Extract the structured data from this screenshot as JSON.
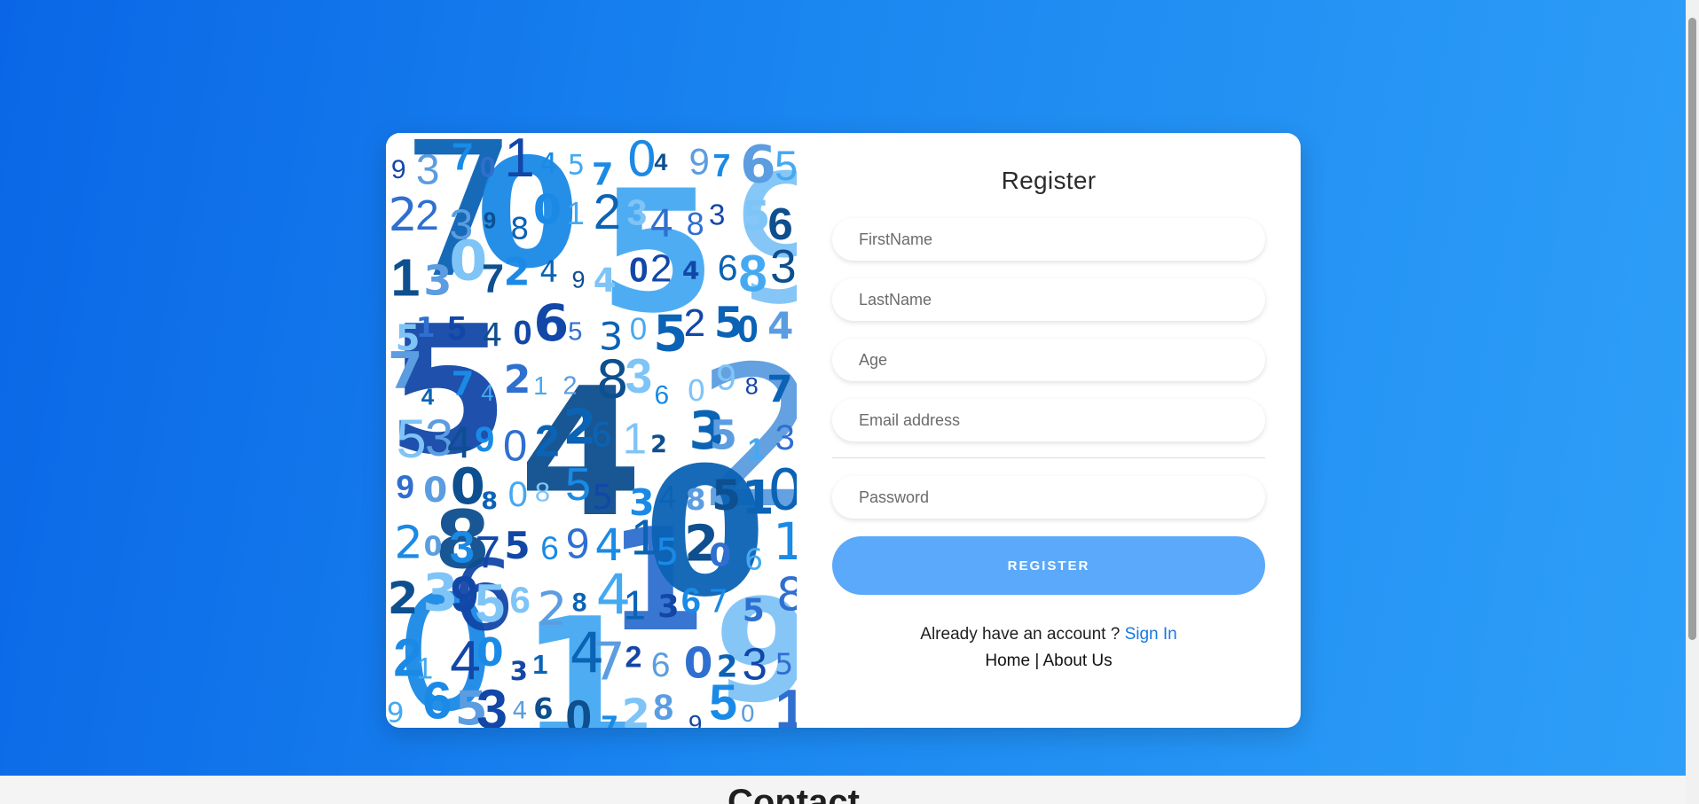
{
  "register": {
    "title": "Register",
    "fields": {
      "first_name_placeholder": "FirstName",
      "last_name_placeholder": "LastName",
      "age_placeholder": "Age",
      "email_placeholder": "Email address",
      "password_placeholder": "Password"
    },
    "submit_label": "REGISTER",
    "account_prompt": "Already have an account ?",
    "signin_label": "Sign In",
    "home_label": "Home",
    "separator": "|",
    "about_label": "About Us"
  },
  "footer": {
    "heading": "Contact"
  },
  "colors": {
    "hero_start": "#0a66e6",
    "hero_end": "#2e9ff8",
    "button": "#5aa9fa",
    "link": "#1878e6"
  },
  "icons": {
    "art": "numbers-pattern-image"
  },
  "art_digits": [
    "9",
    "3",
    "7",
    "0",
    "1",
    "4",
    "5",
    "7",
    "0",
    "4",
    "9",
    "7",
    "6",
    "5",
    "2",
    "2",
    "3",
    "9",
    "8",
    "0",
    "1",
    "2",
    "3",
    "4",
    "8",
    "3",
    "5",
    "6",
    "1",
    "3",
    "0",
    "7",
    "2",
    "4",
    "9",
    "4",
    "0",
    "2",
    "4",
    "6",
    "8",
    "3",
    "5",
    "1",
    "5",
    "4",
    "0",
    "6",
    "5",
    "3",
    "0",
    "5",
    "2",
    "5",
    "0",
    "4",
    "7",
    "4",
    "7",
    "4",
    "2",
    "1",
    "2",
    "8",
    "3",
    "6",
    "0",
    "9",
    "8",
    "7",
    "5",
    "3",
    "4",
    "9",
    "0",
    "2",
    "2",
    "6",
    "1",
    "2",
    "3",
    "5",
    "1",
    "3",
    "9",
    "0",
    "0",
    "8",
    "0",
    "8",
    "5",
    "5",
    "3",
    "4",
    "8",
    "5",
    "1",
    "0",
    "2",
    "0",
    "3",
    "7",
    "5",
    "6",
    "9",
    "4",
    "1",
    "5",
    "2",
    "0",
    "6",
    "1",
    "2",
    "3",
    "9",
    "5",
    "6",
    "2",
    "8",
    "4",
    "1",
    "3",
    "6",
    "7",
    "5",
    "8",
    "2",
    "1",
    "4",
    "0",
    "3",
    "1",
    "4",
    "7",
    "2",
    "6",
    "0",
    "2",
    "3",
    "5",
    "9",
    "6",
    "5",
    "3",
    "4",
    "6",
    "0",
    "7",
    "2",
    "8",
    "9",
    "5",
    "0",
    "1"
  ]
}
